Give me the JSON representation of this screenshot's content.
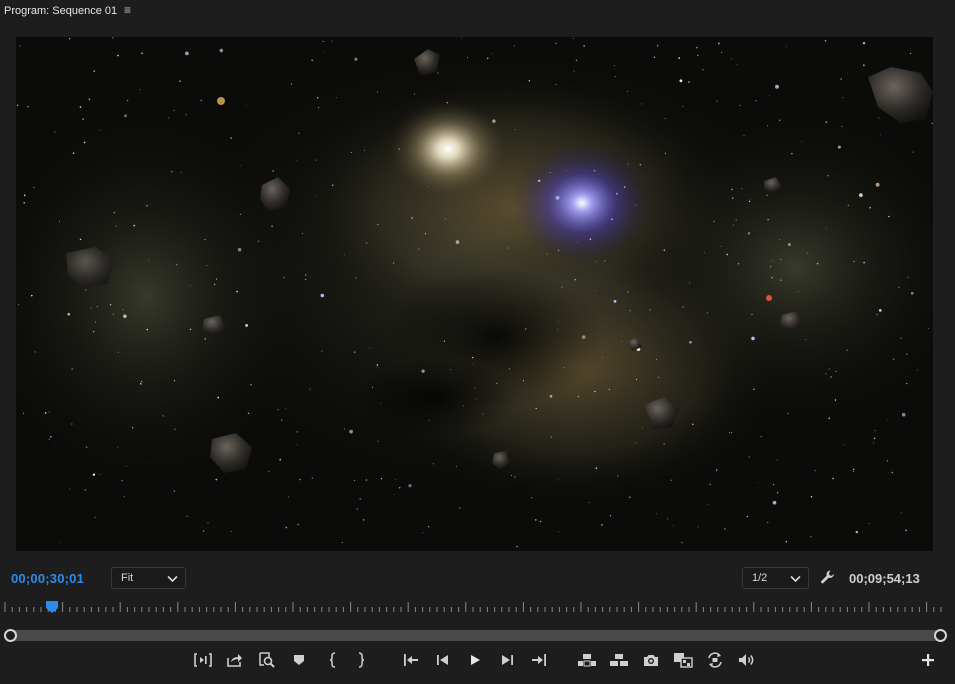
{
  "panel": {
    "title": "Program: Sequence 01",
    "menu_glyph": "≡"
  },
  "viewer": {
    "content": "space-nebula-video-frame"
  },
  "timecode": {
    "current": "00;00;30;01",
    "duration": "00;09;54;13"
  },
  "zoom_select": {
    "value": "Fit"
  },
  "resolution_select": {
    "value": "1/2"
  },
  "timeline": {
    "playhead_position": 0.05
  },
  "colors": {
    "accent": "#2d8ceb",
    "panel_bg": "#1d1d1d",
    "icon": "#cfcfcf"
  },
  "transport_buttons": [
    {
      "name": "insert-edit-point-button",
      "icon": "split-brackets-icon"
    },
    {
      "name": "export-button",
      "icon": "export-tray-icon"
    },
    {
      "name": "inspect-button",
      "icon": "zoom-doc-icon"
    },
    {
      "name": "add-marker-button",
      "icon": "marker-icon"
    },
    {
      "name": "mark-in-button",
      "icon": "mark-in-icon"
    },
    {
      "name": "mark-out-button",
      "icon": "mark-out-icon"
    },
    {
      "name": "go-to-in-button",
      "icon": "go-to-in-icon"
    },
    {
      "name": "step-back-button",
      "icon": "step-back-icon"
    },
    {
      "name": "play-button",
      "icon": "play-icon"
    },
    {
      "name": "step-forward-button",
      "icon": "step-forward-icon"
    },
    {
      "name": "go-to-out-button",
      "icon": "go-to-out-icon"
    },
    {
      "name": "lift-button",
      "icon": "lift-icon"
    },
    {
      "name": "extract-button",
      "icon": "extract-icon"
    },
    {
      "name": "export-frame-button",
      "icon": "camera-icon"
    },
    {
      "name": "comparison-view-button",
      "icon": "comparison-icon"
    },
    {
      "name": "proxy-toggle-button",
      "icon": "proxy-icon"
    },
    {
      "name": "audio-button",
      "icon": "speaker-icon"
    },
    {
      "name": "button-editor-button",
      "icon": "plus-icon"
    }
  ]
}
